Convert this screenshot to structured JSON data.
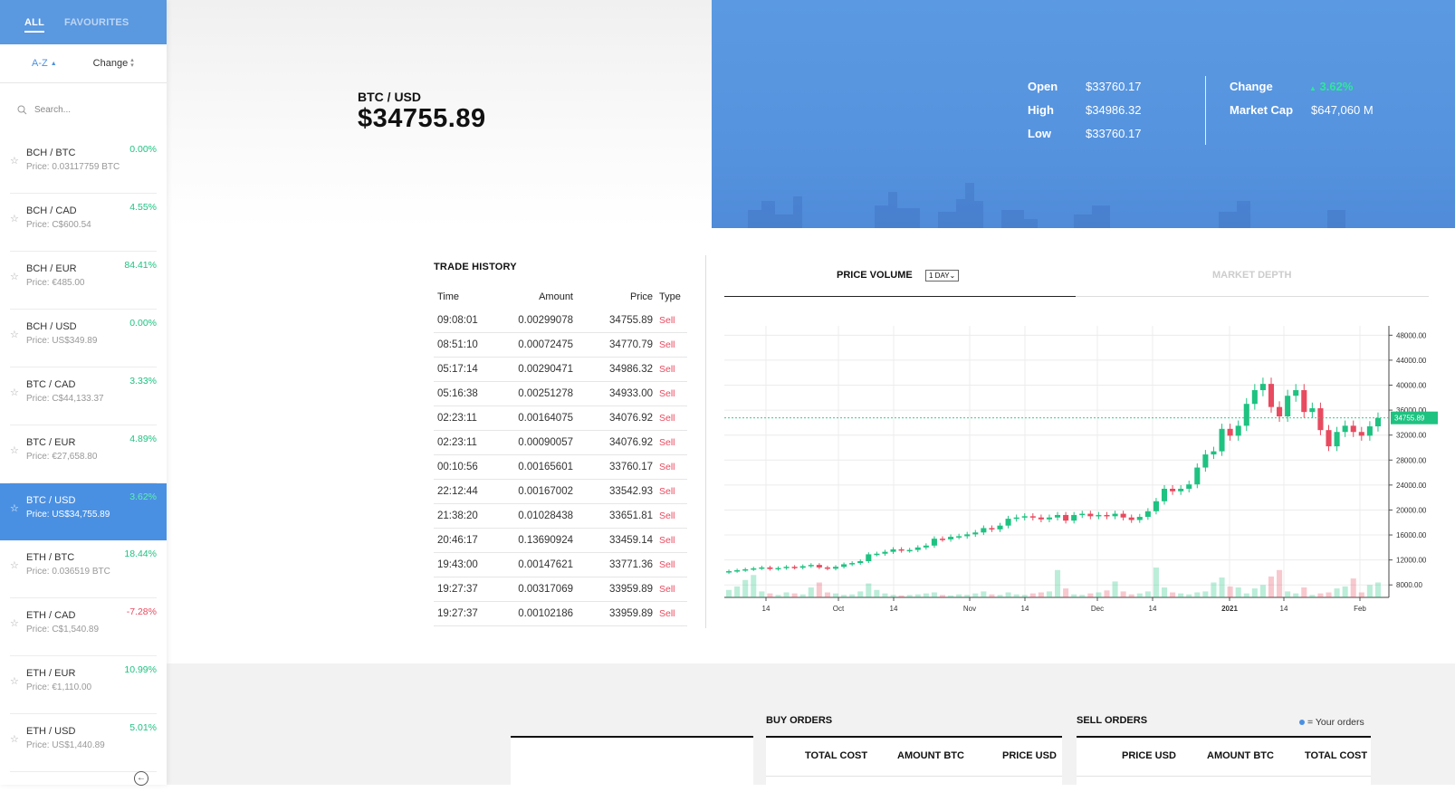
{
  "sidebar": {
    "tabs": [
      "ALL",
      "FAVOURITES"
    ],
    "sort": {
      "az_label": "A-Z",
      "change_label": "Change"
    },
    "search_placeholder": "Search...",
    "pairs": [
      {
        "name": "BCH / BTC",
        "price": "Price: 0.03117759 BTC",
        "change": "0.00%",
        "dir": "up"
      },
      {
        "name": "BCH / CAD",
        "price": "Price: C$600.54",
        "change": "4.55%",
        "dir": "up"
      },
      {
        "name": "BCH / EUR",
        "price": "Price: €485.00",
        "change": "84.41%",
        "dir": "up"
      },
      {
        "name": "BCH / USD",
        "price": "Price: US$349.89",
        "change": "0.00%",
        "dir": "up"
      },
      {
        "name": "BTC / CAD",
        "price": "Price: C$44,133.37",
        "change": "3.33%",
        "dir": "up"
      },
      {
        "name": "BTC / EUR",
        "price": "Price: €27,658.80",
        "change": "4.89%",
        "dir": "up"
      },
      {
        "name": "BTC / USD",
        "price": "Price: US$34,755.89",
        "change": "3.62%",
        "dir": "up",
        "active": true
      },
      {
        "name": "ETH / BTC",
        "price": "Price: 0.036519 BTC",
        "change": "18.44%",
        "dir": "up"
      },
      {
        "name": "ETH / CAD",
        "price": "Price: C$1,540.89",
        "change": "-7.28%",
        "dir": "down"
      },
      {
        "name": "ETH / EUR",
        "price": "Price: €1,110.00",
        "change": "10.99%",
        "dir": "up"
      },
      {
        "name": "ETH / USD",
        "price": "Price: US$1,440.89",
        "change": "5.01%",
        "dir": "up"
      }
    ]
  },
  "header": {
    "pair": "BTC / USD",
    "price": "$34755.89",
    "stats": {
      "open_label": "Open",
      "open": "$33760.17",
      "high_label": "High",
      "high": "$34986.32",
      "low_label": "Low",
      "low": "$33760.17",
      "change_label": "Change",
      "change": "3.62%",
      "mcap_label": "Market Cap",
      "mcap": "$647,060 M"
    }
  },
  "trade_history": {
    "title": "TRADE HISTORY",
    "columns": [
      "Time",
      "Amount",
      "Price",
      "Type"
    ],
    "rows": [
      [
        "09:08:01",
        "0.00299078",
        "34755.89",
        "Sell"
      ],
      [
        "08:51:10",
        "0.00072475",
        "34770.79",
        "Sell"
      ],
      [
        "05:17:14",
        "0.00290471",
        "34986.32",
        "Sell"
      ],
      [
        "05:16:38",
        "0.00251278",
        "34933.00",
        "Sell"
      ],
      [
        "02:23:11",
        "0.00164075",
        "34076.92",
        "Sell"
      ],
      [
        "02:23:11",
        "0.00090057",
        "34076.92",
        "Sell"
      ],
      [
        "00:10:56",
        "0.00165601",
        "33760.17",
        "Sell"
      ],
      [
        "22:12:44",
        "0.00167002",
        "33542.93",
        "Sell"
      ],
      [
        "21:38:20",
        "0.01028438",
        "33651.81",
        "Sell"
      ],
      [
        "20:46:17",
        "0.13690924",
        "33459.14",
        "Sell"
      ],
      [
        "19:43:00",
        "0.00147621",
        "33771.36",
        "Sell"
      ],
      [
        "19:27:37",
        "0.00317069",
        "33959.89",
        "Sell"
      ],
      [
        "19:27:37",
        "0.00102186",
        "33959.89",
        "Sell"
      ]
    ]
  },
  "chart_tabs": {
    "price_volume": "PRICE VOLUME",
    "range": "1 DAY",
    "market_depth": "MARKET DEPTH"
  },
  "chart_data": {
    "type": "candlestick",
    "y_ticks": [
      "48000.00",
      "44000.00",
      "40000.00",
      "36000.00",
      "32000.00",
      "28000.00",
      "24000.00",
      "20000.00",
      "16000.00",
      "12000.00",
      "8000.00"
    ],
    "ylim": [
      6000,
      49500
    ],
    "x_ticks": [
      "14",
      "Oct",
      "14",
      "Nov",
      "14",
      "Dec",
      "14",
      "2021",
      "14",
      "Feb"
    ],
    "current_price_label": "34755.89",
    "current_price": 34755.89,
    "close_series": [
      10200,
      10350,
      10500,
      10650,
      10800,
      10550,
      10700,
      10900,
      10750,
      11000,
      11200,
      10800,
      10600,
      10900,
      11300,
      11500,
      11800,
      12900,
      13000,
      13300,
      13700,
      13500,
      13600,
      14000,
      14300,
      15400,
      15300,
      15700,
      15800,
      16100,
      16400,
      17100,
      16900,
      17500,
      18600,
      18800,
      19000,
      18800,
      18500,
      18800,
      19200,
      18300,
      19200,
      19400,
      19000,
      19200,
      19000,
      19400,
      18800,
      18400,
      18900,
      19800,
      21400,
      23400,
      23000,
      23400,
      24100,
      26800,
      28900,
      29400,
      33000,
      31900,
      33500,
      37000,
      39200,
      40200,
      36500,
      35000,
      38300,
      39200,
      35700,
      36300,
      32800,
      30200,
      32500,
      33500,
      32500,
      31900,
      33400,
      34755.89
    ],
    "volume_series": [
      0.15,
      0.22,
      0.35,
      0.45,
      0.12,
      0.08,
      0.05,
      0.1,
      0.08,
      0.06,
      0.2,
      0.3,
      0.1,
      0.08,
      0.05,
      0.06,
      0.12,
      0.28,
      0.15,
      0.08,
      0.05,
      0.04,
      0.05,
      0.06,
      0.08,
      0.1,
      0.05,
      0.04,
      0.06,
      0.05,
      0.08,
      0.12,
      0.06,
      0.05,
      0.1,
      0.06,
      0.05,
      0.08,
      0.1,
      0.12,
      0.55,
      0.18,
      0.06,
      0.05,
      0.08,
      0.1,
      0.14,
      0.32,
      0.12,
      0.06,
      0.08,
      0.12,
      0.6,
      0.2,
      0.1,
      0.08,
      0.06,
      0.1,
      0.12,
      0.3,
      0.4,
      0.22,
      0.2,
      0.08,
      0.18,
      0.25,
      0.42,
      0.55,
      0.12,
      0.08,
      0.2,
      0.05,
      0.08,
      0.1,
      0.18,
      0.22,
      0.38,
      0.1,
      0.25,
      0.3
    ]
  },
  "orders": {
    "buy_title": "BUY ORDERS",
    "buy_columns": [
      "TOTAL COST",
      "AMOUNT BTC",
      "PRICE USD"
    ],
    "sell_title": "SELL ORDERS",
    "sell_columns": [
      "PRICE USD",
      "AMOUNT BTC",
      "TOTAL COST"
    ],
    "your_orders": "= Your orders"
  },
  "colors": {
    "accent": "#5a98e0",
    "up": "#1ec281",
    "down": "#e84a5f"
  },
  "icons": {
    "star": "star-icon",
    "search": "search-icon",
    "sort": "sort-icon",
    "collapse": "arrow-left-circle-icon"
  }
}
